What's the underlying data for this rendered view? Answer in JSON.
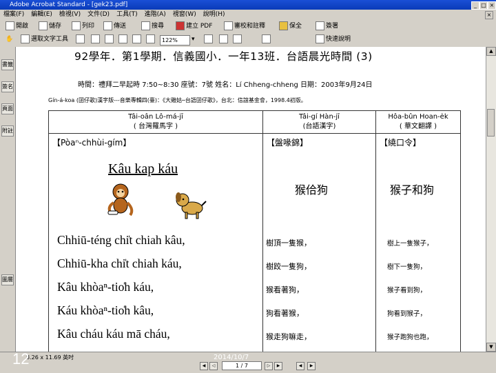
{
  "window": {
    "title": "Adobe Acrobat Standard - [gek23.pdf]",
    "min": "_",
    "max": "□",
    "close": "×"
  },
  "menu": [
    "檔案(F)",
    "編輯(E)",
    "檢視(V)",
    "文件(D)",
    "工具(T)",
    "進階(A)",
    "視窗(W)",
    "說明(H)"
  ],
  "toolbar1": {
    "open": "開啟",
    "save": "儲存",
    "print": "列印",
    "email": "傳送",
    "search": "搜尋",
    "create_pdf": "建立 PDF",
    "review": "審校和註釋",
    "secure": "保全",
    "sign": "簽署"
  },
  "toolbar2": {
    "select_text": "選取文字工具",
    "zoom": "122%",
    "help": "快速說明"
  },
  "nav_tabs": [
    "書籤",
    "簽名",
    "頁面",
    "附註",
    "圖層"
  ],
  "document": {
    "title": "92學年．第1學期．信義國小．一年13班．台語晨光時間",
    "title_num": "(3)",
    "subtitle": "時間：禮拜二早起時  7:50~8:30    座號：7號   姓名：Lí Chheng-chheng   日期：2003年9月24日",
    "source": "Gín-á-koa (囝仔歌)漢字版---音樂專輯四(臺)：《大雞姑─台語囝仔歌》，台北：信誼基金會，1998.4初版。",
    "col1_header_1": "Tâi-oân Lô-má-jī",
    "col1_header_2": "( 台灣羅馬字 )",
    "col2_header_1": "Tâi-gí Hàn-jī",
    "col2_header_2": "(台語漢字)",
    "col3_header_1": "Hôa-bûn Hoan-e̍k",
    "col3_header_2": "( 華文翻譯 )",
    "sec1": "【Pòaⁿ-chhùi-gím】",
    "sec2": "【盤喙錦】",
    "sec3": "【繞口令】",
    "story_title": "Kâu kap káu",
    "story_title_hanji": "猴佮狗",
    "story_title_chinese": "猴子和狗",
    "lines_poj": [
      "Chhiū-téng chi̍t chiah kâu,",
      "Chhiū-kha chi̍t chiah káu,",
      "Kâu khòaⁿ-tio̍h káu,",
      "Káu khòaⁿ-tio̍h kâu,",
      "Kâu cháu káu mā cháu,"
    ],
    "lines_hanji": [
      "樹頂一隻猴，",
      "樹跤一隻狗，",
      "猴看著狗，",
      "狗看著猴，",
      "猴走狗嘛走，"
    ],
    "lines_chinese": [
      "樹上一隻猴子，",
      "樹下一隻狗，",
      "猴子看到狗，",
      "狗看到猴子，",
      "猴子跑狗也跑，"
    ]
  },
  "status": {
    "size": "8.26 x 11.69 英吋",
    "page": "1 / 7",
    "slide_number": "12",
    "slide_date": "2014/10/7"
  }
}
